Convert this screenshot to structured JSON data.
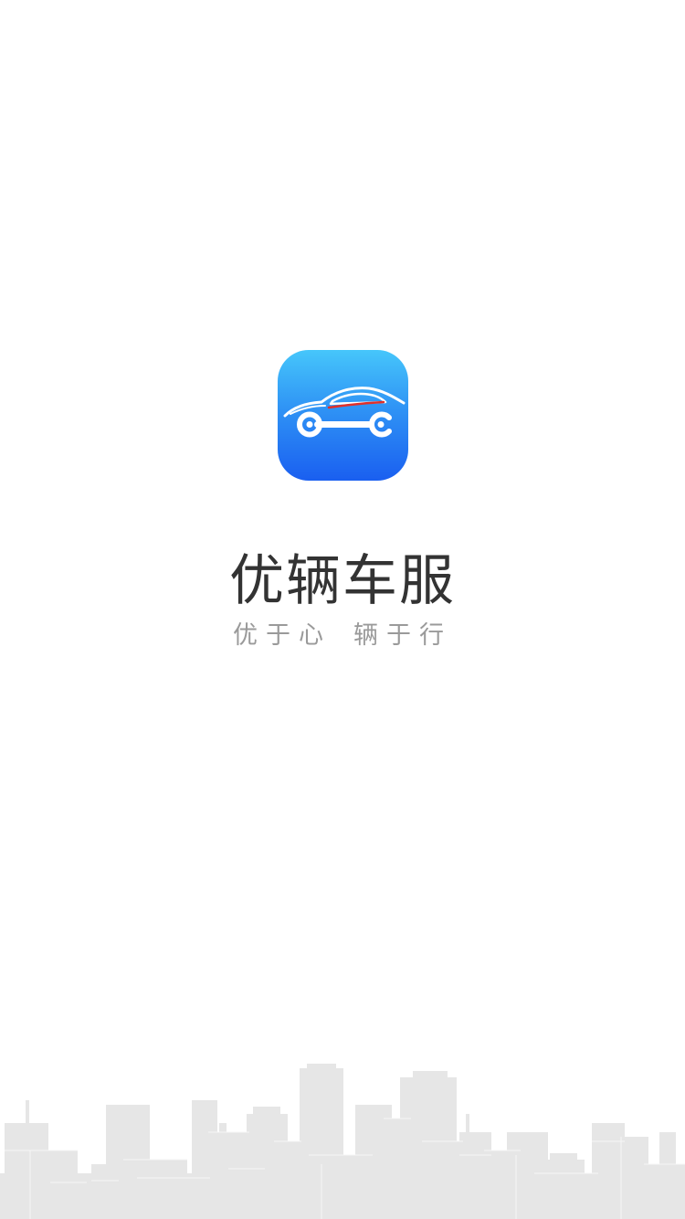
{
  "app": {
    "name": "优辆车服",
    "slogan_part1": "优于心",
    "slogan_part2": "辆于行"
  },
  "colors": {
    "background": "#ffffff",
    "icon_gradient_top": "#46c6fb",
    "icon_gradient_bottom": "#1a5ff0",
    "icon_accent": "#e0302a",
    "title_text": "#333333",
    "slogan_text": "#9a9a9a",
    "skyline": "#e4e4e4"
  },
  "icons": {
    "logo": "car-wrench-icon",
    "background": "city-skyline-illustration"
  }
}
